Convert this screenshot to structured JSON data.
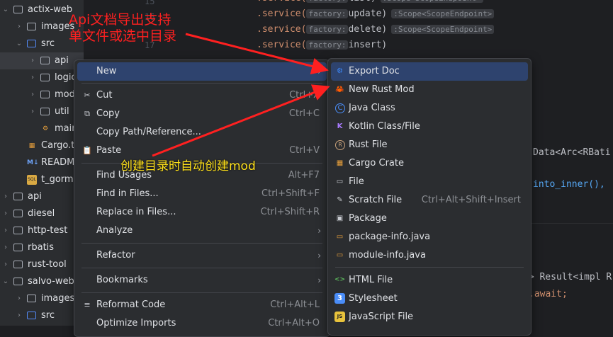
{
  "tree": {
    "items": [
      {
        "label": "actix-web",
        "kind": "folder"
      },
      {
        "label": "images",
        "kind": "folder"
      },
      {
        "label": "src",
        "kind": "folder"
      },
      {
        "label": "api",
        "kind": "folder"
      },
      {
        "label": "logic",
        "kind": "folder"
      },
      {
        "label": "mode",
        "kind": "folder"
      },
      {
        "label": "util",
        "kind": "folder"
      },
      {
        "label": "main",
        "kind": "rust-file"
      },
      {
        "label": "Cargo.t",
        "kind": "cargo-file"
      },
      {
        "label": "README",
        "kind": "markdown-file"
      },
      {
        "label": "t_gorm.",
        "kind": "sql-file"
      },
      {
        "label": "api",
        "kind": "folder"
      },
      {
        "label": "diesel",
        "kind": "folder"
      },
      {
        "label": "http-test",
        "kind": "folder"
      },
      {
        "label": "rbatis",
        "kind": "folder"
      },
      {
        "label": "rust-tool",
        "kind": "folder"
      },
      {
        "label": "salvo-web",
        "kind": "folder"
      },
      {
        "label": "images",
        "kind": "folder"
      },
      {
        "label": "src",
        "kind": "folder"
      }
    ],
    "md_badge": "M↓",
    "sql_badge": "SQL"
  },
  "editor": {
    "gutter": [
      "15",
      "16",
      "17"
    ],
    "lines": [
      {
        "prefix": ".service(",
        "hint": "factory:",
        "arg": "list)",
        "tail": ":Scope<ScopeEndpoint>"
      },
      {
        "prefix": ".service(",
        "hint": "factory:",
        "arg": "update)",
        "tail": ":Scope<ScopeEndpoint>"
      },
      {
        "prefix": ".service(",
        "hint": "factory:",
        "arg": "delete)",
        "tail": ":Scope<ScopeEndpoint>"
      },
      {
        "prefix": ".service(",
        "hint": "factory:",
        "arg": "insert)",
        "tail": ""
      }
    ],
    "frag_data": "Data<Arc<RBati",
    "frag_into": "into_inner(),",
    "frag_result": "-> Result<impl R",
    "frag_await": ".await;"
  },
  "context_menu": {
    "items": [
      {
        "label": "New",
        "shortcut": "",
        "arrow": true,
        "icon": ""
      },
      {
        "label": "Cut",
        "shortcut": "Ctrl+X",
        "arrow": false,
        "icon": "✂"
      },
      {
        "label": "Copy",
        "shortcut": "Ctrl+C",
        "arrow": false,
        "icon": "⧉"
      },
      {
        "label": "Copy Path/Reference...",
        "shortcut": "",
        "arrow": false,
        "icon": ""
      },
      {
        "label": "Paste",
        "shortcut": "Ctrl+V",
        "arrow": false,
        "icon": "📋"
      },
      {
        "label": "Find Usages",
        "shortcut": "Alt+F7",
        "arrow": false,
        "icon": ""
      },
      {
        "label": "Find in Files...",
        "shortcut": "Ctrl+Shift+F",
        "arrow": false,
        "icon": ""
      },
      {
        "label": "Replace in Files...",
        "shortcut": "Ctrl+Shift+R",
        "arrow": false,
        "icon": ""
      },
      {
        "label": "Analyze",
        "shortcut": "",
        "arrow": true,
        "icon": ""
      },
      {
        "label": "Refactor",
        "shortcut": "",
        "arrow": true,
        "icon": ""
      },
      {
        "label": "Bookmarks",
        "shortcut": "",
        "arrow": true,
        "icon": ""
      },
      {
        "label": "Reformat Code",
        "shortcut": "Ctrl+Alt+L",
        "arrow": false,
        "icon": "≡"
      },
      {
        "label": "Optimize Imports",
        "shortcut": "Ctrl+Alt+O",
        "arrow": false,
        "icon": ""
      }
    ],
    "arrow_glyph": "›"
  },
  "submenu": {
    "items": [
      {
        "label": "Export Doc",
        "shortcut": "",
        "icon": "export-doc-icon",
        "glyph": "⚙",
        "color": "#3d8bfd"
      },
      {
        "label": "New Rust Mod",
        "shortcut": "",
        "icon": "crab-icon",
        "glyph": "🦀",
        "color": "#e8602c"
      },
      {
        "label": "Java Class",
        "shortcut": "",
        "icon": "java-class-icon",
        "glyph": "C",
        "color": "#4a8df8"
      },
      {
        "label": "Kotlin Class/File",
        "shortcut": "",
        "icon": "kotlin-icon",
        "glyph": "K",
        "color": "#a97bff"
      },
      {
        "label": "Rust File",
        "shortcut": "",
        "icon": "rust-icon",
        "glyph": "R",
        "color": "#c9a27b"
      },
      {
        "label": "Cargo Crate",
        "shortcut": "",
        "icon": "cargo-icon",
        "glyph": "▦",
        "color": "#e8a03c"
      },
      {
        "label": "File",
        "shortcut": "",
        "icon": "file-icon",
        "glyph": "▭",
        "color": "#c9ccd2"
      },
      {
        "label": "Scratch File",
        "shortcut": "Ctrl+Alt+Shift+Insert",
        "icon": "scratch-icon",
        "glyph": "✎",
        "color": "#c9ccd2"
      },
      {
        "label": "Package",
        "shortcut": "",
        "icon": "package-icon",
        "glyph": "▣",
        "color": "#c9ccd2"
      },
      {
        "label": "package-info.java",
        "shortcut": "",
        "icon": "java-file-icon",
        "glyph": "▭",
        "color": "#e8a03c"
      },
      {
        "label": "module-info.java",
        "shortcut": "",
        "icon": "java-file-icon",
        "glyph": "▭",
        "color": "#e8a03c"
      },
      {
        "label": "HTML File",
        "shortcut": "",
        "icon": "html-icon",
        "glyph": "<>",
        "color": "#5cb85c"
      },
      {
        "label": "Stylesheet",
        "shortcut": "",
        "icon": "css-icon",
        "glyph": "3",
        "color": "#4a8df8"
      },
      {
        "label": "JavaScript File",
        "shortcut": "",
        "icon": "js-icon",
        "glyph": "JS",
        "color": "#e8c33c"
      }
    ]
  },
  "annotations": {
    "top_line1": "Api文档导出支持",
    "top_line2": "单文件或选中目录",
    "middle": "创建目录时自动创建mod",
    "top_color": "#ff2020",
    "middle_color": "#ffe11a"
  }
}
